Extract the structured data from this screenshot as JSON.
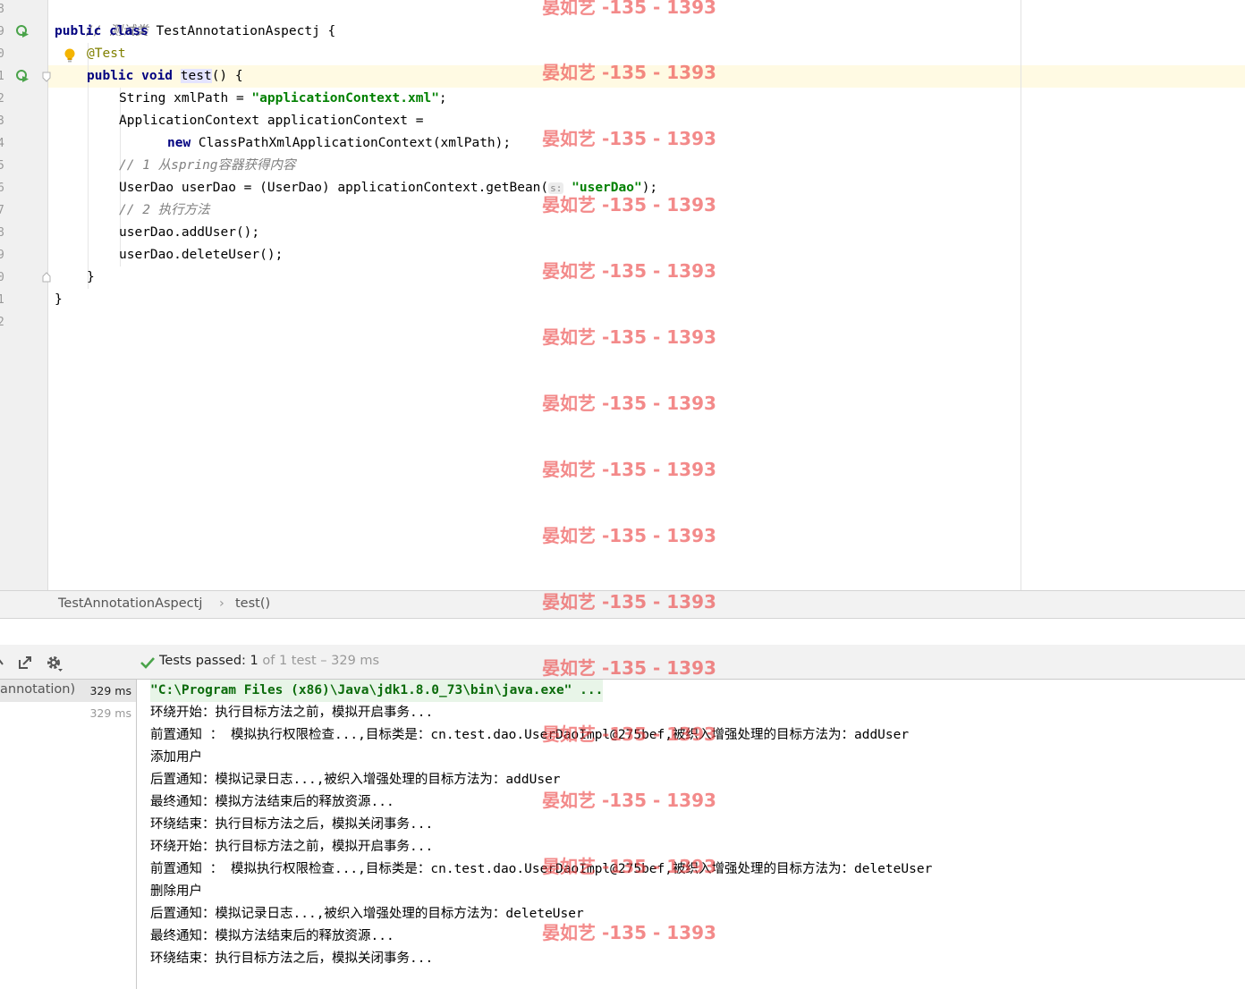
{
  "editor": {
    "line_numbers": [
      "8",
      "9",
      "0",
      "1",
      "2",
      "3",
      "4",
      "5",
      "6",
      "7",
      "8",
      "9",
      "0",
      "1",
      "2"
    ],
    "lines": {
      "l8_comment": "// 测试类",
      "l9_kw": "public class",
      "l9_rest": " TestAnnotationAspectj {",
      "l10_ann": "@Test",
      "l11_kw": "public void",
      "l11_name": "test",
      "l11_rest": "() {",
      "l12_a": "String xmlPath = ",
      "l12_str": "\"applicationContext.xml\"",
      "l12_b": ";",
      "l13": "ApplicationContext applicationContext =",
      "l14_kw": "new",
      "l14_rest": " ClassPathXmlApplicationContext(xmlPath);",
      "l15_comment": "// 1 从spring容器获得内容",
      "l16_a": "UserDao userDao = (UserDao) applicationContext.getBean(",
      "l16_hint": "s:",
      "l16_str": "\"userDao\"",
      "l16_b": ");",
      "l17_comment": "// 2 执行方法",
      "l18": "userDao.addUser();",
      "l19": "userDao.deleteUser();",
      "l20": "}",
      "l21": "}"
    }
  },
  "breadcrumb": {
    "class_name": "TestAnnotationAspectj",
    "separator": "›",
    "method_name": "test()"
  },
  "run_panel": {
    "status_prefix": "Tests passed: ",
    "passed_count": "1",
    "status_of": " of 1 test – 329 ms",
    "tree": [
      {
        "label": "annotation)",
        "time": "329 ms"
      },
      {
        "label": "",
        "time": "329 ms"
      }
    ],
    "console_lines": [
      "\"C:\\Program Files (x86)\\Java\\jdk1.8.0_73\\bin\\java.exe\" ...",
      "环绕开始：执行目标方法之前，模拟开启事务...",
      "前置通知 ： 模拟执行权限检查...,目标类是：cn.test.dao.UserDaoImpl@275bef,被织入增强处理的目标方法为：addUser",
      "添加用户",
      "后置通知：模拟记录日志...,被织入增强处理的目标方法为：addUser",
      "最终通知：模拟方法结束后的释放资源...",
      "环绕结束：执行目标方法之后，模拟关闭事务...",
      "环绕开始：执行目标方法之前，模拟开启事务...",
      "前置通知 ： 模拟执行权限检查...,目标类是：cn.test.dao.UserDaoImpl@275bef,被织入增强处理的目标方法为：deleteUser",
      "删除用户",
      "后置通知：模拟记录日志...,被织入增强处理的目标方法为：deleteUser",
      "最终通知：模拟方法结束后的释放资源...",
      "环绕结束：执行目标方法之后，模拟关闭事务..."
    ]
  },
  "watermark": {
    "text": "晏如艺 -135 - 1393"
  },
  "colors": {
    "keyword": "#000080",
    "string": "#008000",
    "comment": "#808080",
    "annotation": "#808000",
    "pass_green": "#4aa34a",
    "watermark": "#eb3c3c"
  }
}
